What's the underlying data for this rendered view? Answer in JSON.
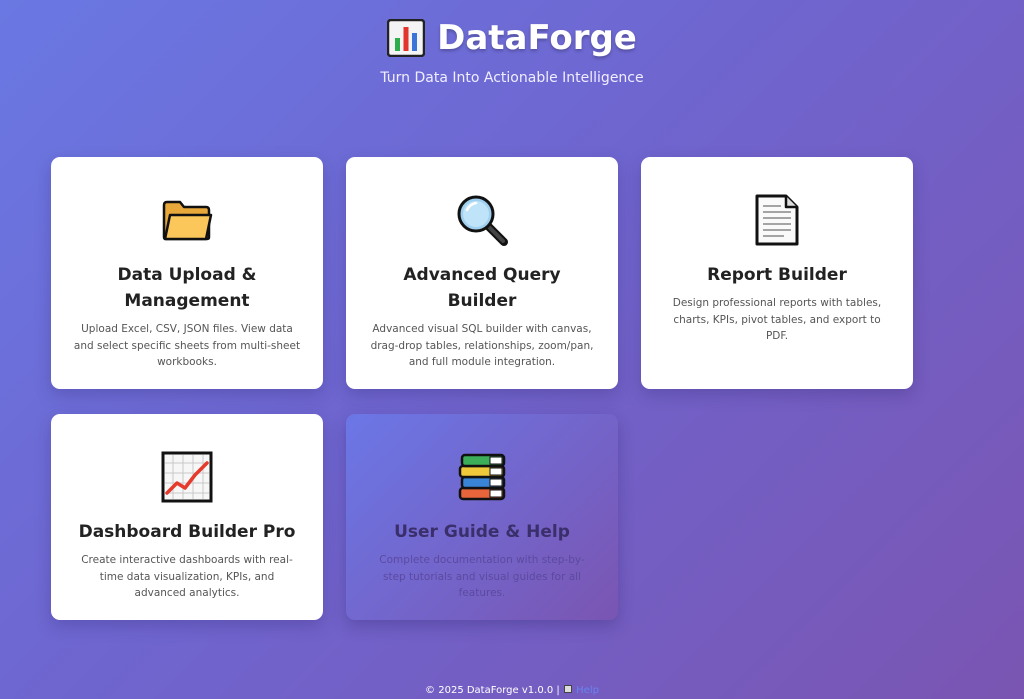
{
  "header": {
    "brand_icon": "bar-chart-icon",
    "title": "DataForge",
    "tagline": "Turn Data Into Actionable Intelligence"
  },
  "cards": [
    {
      "icon": "folder-icon",
      "title": "Data Upload & Management",
      "description": "Upload Excel, CSV, JSON files. View data and select specific sheets from multi-sheet workbooks."
    },
    {
      "icon": "magnifier-icon",
      "title": "Advanced Query Builder",
      "description": "Advanced visual SQL builder with canvas, drag-drop tables, relationships, zoom/pan, and full module integration."
    },
    {
      "icon": "document-icon",
      "title": "Report Builder",
      "description": "Design professional reports with tables, charts, KPIs, pivot tables, and export to PDF."
    },
    {
      "icon": "line-chart-icon",
      "title": "Dashboard Builder Pro",
      "description": "Create interactive dashboards with real-time data visualization, KPIs, and advanced analytics."
    },
    {
      "icon": "books-icon",
      "title": "User Guide & Help",
      "description": "Complete documentation with step-by-step tutorials and visual guides for all features."
    }
  ],
  "footer": {
    "copyright": "© 2025 DataForge v1.0.0 | ",
    "help_icon": "book-icon",
    "help_label": "Help"
  },
  "colors": {
    "bg_start": "#6a78e3",
    "bg_end": "#7a55b2",
    "card_bg": "#ffffff",
    "title_text": "#222222",
    "body_text": "#555555",
    "help_link": "#6a82f0"
  }
}
